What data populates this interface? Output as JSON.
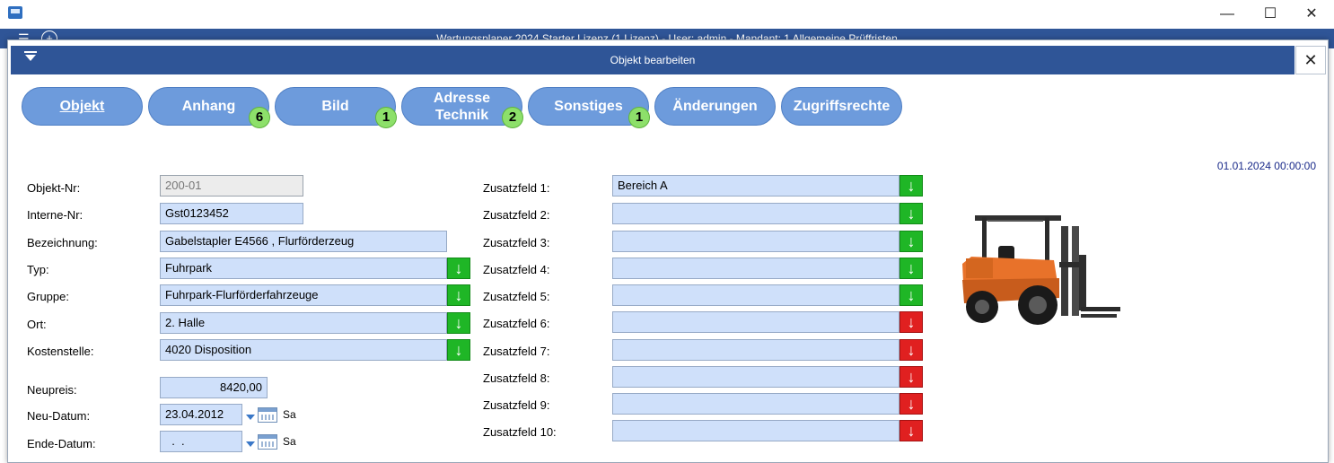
{
  "window": {
    "app_title": "Wartungsplaner 2024 Starter Lizenz (1 Lizenz) - User: admin - Mandant: 1 Allgemeine Prüffristen",
    "controls": {
      "minimize": "—",
      "maximize": "☐",
      "close": "✕"
    }
  },
  "dialog": {
    "title": "Objekt bearbeiten",
    "close": "✕",
    "date": "01.01.2024 00:00:00"
  },
  "tabs": [
    {
      "label": "Objekt",
      "badge": "",
      "active": true
    },
    {
      "label": "Anhang",
      "badge": "6"
    },
    {
      "label": "Bild",
      "badge": "1"
    },
    {
      "label": "Adresse\nTechnik",
      "badge": "2"
    },
    {
      "label": "Sonstiges",
      "badge": "1"
    },
    {
      "label": "Änderungen",
      "badge": ""
    },
    {
      "label": "Zugriffsrechte",
      "badge": ""
    }
  ],
  "form": {
    "objekt_nr": {
      "label": "Objekt-Nr:",
      "value": "200-01"
    },
    "interne_nr": {
      "label": "Interne-Nr:",
      "value": "Gst0123452"
    },
    "bezeichnung": {
      "label": "Bezeichnung:",
      "value": "Gabelstapler E4566 , Flurförderzeug"
    },
    "typ": {
      "label": "Typ:",
      "value": "Fuhrpark"
    },
    "gruppe": {
      "label": "Gruppe:",
      "value": "Fuhrpark-Flurförderfahrzeuge"
    },
    "ort": {
      "label": "Ort:",
      "value": "2. Halle"
    },
    "kostenstelle": {
      "label": "Kostenstelle:",
      "value": "4020 Disposition"
    },
    "neupreis": {
      "label": "Neupreis:",
      "value": "8420,00"
    },
    "neu_datum": {
      "label": "Neu-Datum:",
      "value": "23.04.2012",
      "weekday": "Sa"
    },
    "ende_datum": {
      "label": "Ende-Datum:",
      "value": "  .  .",
      "weekday": "Sa"
    }
  },
  "zusatz": [
    {
      "label": "Zusatzfeld 1:",
      "value": "Bereich A",
      "status": "green"
    },
    {
      "label": "Zusatzfeld 2:",
      "value": "",
      "status": "green"
    },
    {
      "label": "Zusatzfeld 3:",
      "value": "",
      "status": "green"
    },
    {
      "label": "Zusatzfeld 4:",
      "value": "",
      "status": "green"
    },
    {
      "label": "Zusatzfeld 5:",
      "value": "",
      "status": "green"
    },
    {
      "label": "Zusatzfeld 6:",
      "value": "",
      "status": "red"
    },
    {
      "label": "Zusatzfeld 7:",
      "value": "",
      "status": "red"
    },
    {
      "label": "Zusatzfeld 8:",
      "value": "",
      "status": "red"
    },
    {
      "label": "Zusatzfeld 9:",
      "value": "",
      "status": "red"
    },
    {
      "label": "Zusatzfeld 10:",
      "value": "",
      "status": "red"
    }
  ],
  "icons": {
    "arrow_down": "↓"
  },
  "colors": {
    "header_blue": "#2f5597",
    "tab_blue": "#6d9bdc",
    "field_blue": "#cfe0fa",
    "ok_green": "#1fb626",
    "alert_red": "#e02020",
    "badge_green": "#8de06a"
  },
  "picture": {
    "icon": "forklift-image"
  }
}
